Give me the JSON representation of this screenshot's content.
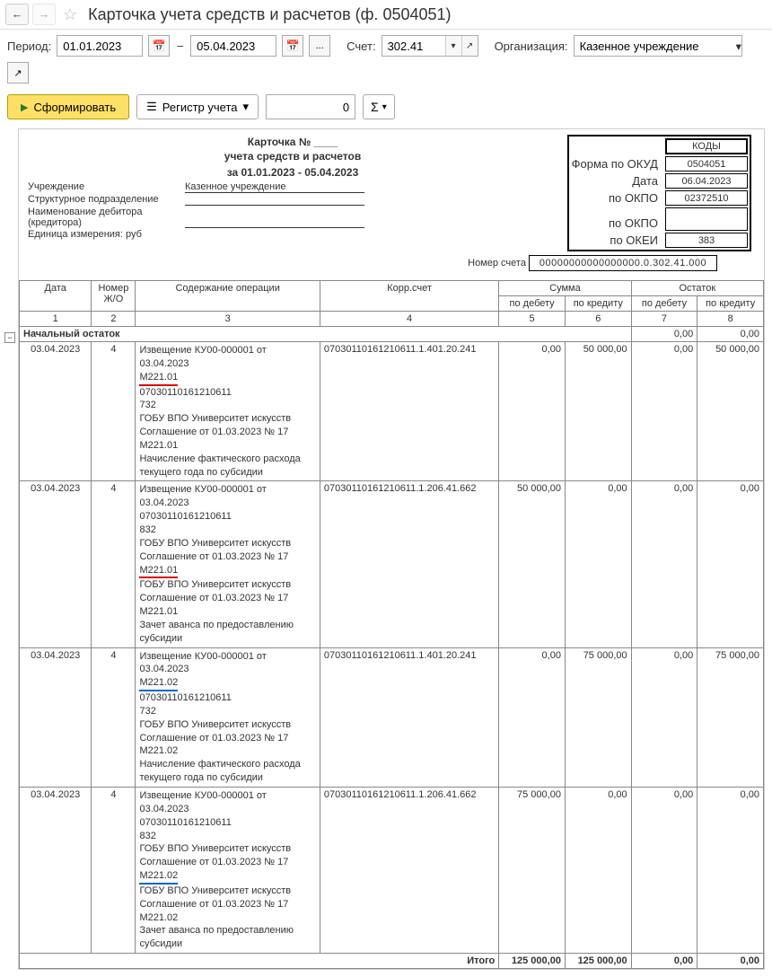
{
  "title": "Карточка учета средств и расчетов (ф. 0504051)",
  "params": {
    "period_label": "Период:",
    "date_from": "01.01.2023",
    "date_to": "05.04.2023",
    "ellipsis": "...",
    "account_label": "Счет:",
    "account": "302.41",
    "org_label": "Организация:",
    "org": "Казенное учреждение"
  },
  "actions": {
    "form": "Сформировать",
    "register": "Регистр учета",
    "num": "0",
    "sigma": "Σ"
  },
  "report_header": {
    "title1": "Карточка № ____",
    "title2": "учета средств и расчетов",
    "period_line": "за 01.01.2023 - 05.04.2023",
    "institution_label": "Учреждение",
    "institution_value": "Казенное учреждение",
    "subdiv_label": "Структурное подразделение",
    "debtor_label": "Наименование дебитора (кредитора)",
    "unit_label": "Единица измерения: руб",
    "acct_num_label": "Номер счета",
    "acct_num_value": "00000000000000000.0.302.41.000"
  },
  "codes": {
    "hdr": "КОДЫ",
    "okud_label": "Форма по ОКУД",
    "okud": "0504051",
    "date_label": "Дата",
    "date": "06.04.2023",
    "okpo1_label": "по ОКПО",
    "okpo1": "02372510",
    "okpo2_label": "по ОКПО",
    "okpo2": "",
    "okei_label": "по ОКЕИ",
    "okei": "383"
  },
  "grid": {
    "hdr_date": "Дата",
    "hdr_jo": "Номер Ж/О",
    "hdr_desc": "Содержание операции",
    "hdr_corr": "Корр.счет",
    "hdr_sum": "Сумма",
    "hdr_bal": "Остаток",
    "hdr_debit": "по дебету",
    "hdr_credit": "по кредиту",
    "n1": "1",
    "n2": "2",
    "n3": "3",
    "n4": "4",
    "n5": "5",
    "n6": "6",
    "n7": "7",
    "n8": "8",
    "start_label": "Начальный остаток",
    "start_od": "0,00",
    "start_ok": "0,00",
    "total_label": "Итого",
    "total_sd": "125 000,00",
    "total_sk": "125 000,00",
    "total_od": "0,00",
    "total_ok": "0,00"
  },
  "rows": [
    {
      "date": "03.04.2023",
      "jo": "4",
      "desc": {
        "l1": "Извещение КУ00-000001 от 03.04.2023",
        "hl": "М221.01",
        "hl_style": "red",
        "l3": "07030110161210611",
        "l4": "732",
        "l5": "ГОБУ ВПО Университет искусств",
        "l6": "Соглашение от 01.03.2023 № 17",
        "l7": "М221.01",
        "l8": "Начисление фактического расхода текущего года по субсидии"
      },
      "corr": "07030110161210611.1.401.20.241",
      "sd": "0,00",
      "sk": "50 000,00",
      "od": "0,00",
      "ok": "50 000,00"
    },
    {
      "date": "03.04.2023",
      "jo": "4",
      "desc": {
        "l1": "Извещение КУ00-000001 от 03.04.2023",
        "hl": "",
        "hl_style": "",
        "l3": "07030110161210611",
        "l4": "832",
        "l5": "ГОБУ ВПО Университет искусств",
        "l6": "Соглашение от 01.03.2023 № 17",
        "m_hl": "М221.01",
        "m_hl_style": "red",
        "l7": "ГОБУ ВПО Университет искусств",
        "l7b": "Соглашение от 01.03.2023 № 17",
        "l7c": "М221.01",
        "l8": "Зачет аванса по предоставлению субсидии"
      },
      "corr": "07030110161210611.1.206.41.662",
      "sd": "50 000,00",
      "sk": "0,00",
      "od": "0,00",
      "ok": "0,00"
    },
    {
      "date": "03.04.2023",
      "jo": "4",
      "desc": {
        "l1": "Извещение КУ00-000001 от 03.04.2023",
        "hl": "М221.02",
        "hl_style": "blue",
        "l3": "07030110161210611",
        "l4": "732",
        "l5": "ГОБУ ВПО Университет искусств",
        "l6": "Соглашение от 01.03.2023 № 17",
        "l7": "М221.02",
        "l8": "Начисление фактического расхода текущего года по субсидии"
      },
      "corr": "07030110161210611.1.401.20.241",
      "sd": "0,00",
      "sk": "75 000,00",
      "od": "0,00",
      "ok": "75 000,00"
    },
    {
      "date": "03.04.2023",
      "jo": "4",
      "desc": {
        "l1": "Извещение КУ00-000001 от 03.04.2023",
        "hl": "",
        "hl_style": "",
        "l3": "07030110161210611",
        "l4": "832",
        "l5": "ГОБУ ВПО Университет искусств",
        "l6": "Соглашение от 01.03.2023 № 17",
        "m_hl": "М221.02",
        "m_hl_style": "blue",
        "l7": "ГОБУ ВПО Университет искусств",
        "l7b": "Соглашение от 01.03.2023 № 17",
        "l7c": "М221.02",
        "l8": "Зачет аванса по предоставлению субсидии"
      },
      "corr": "07030110161210611.1.206.41.662",
      "sd": "75 000,00",
      "sk": "0,00",
      "od": "0,00",
      "ok": "0,00"
    }
  ]
}
